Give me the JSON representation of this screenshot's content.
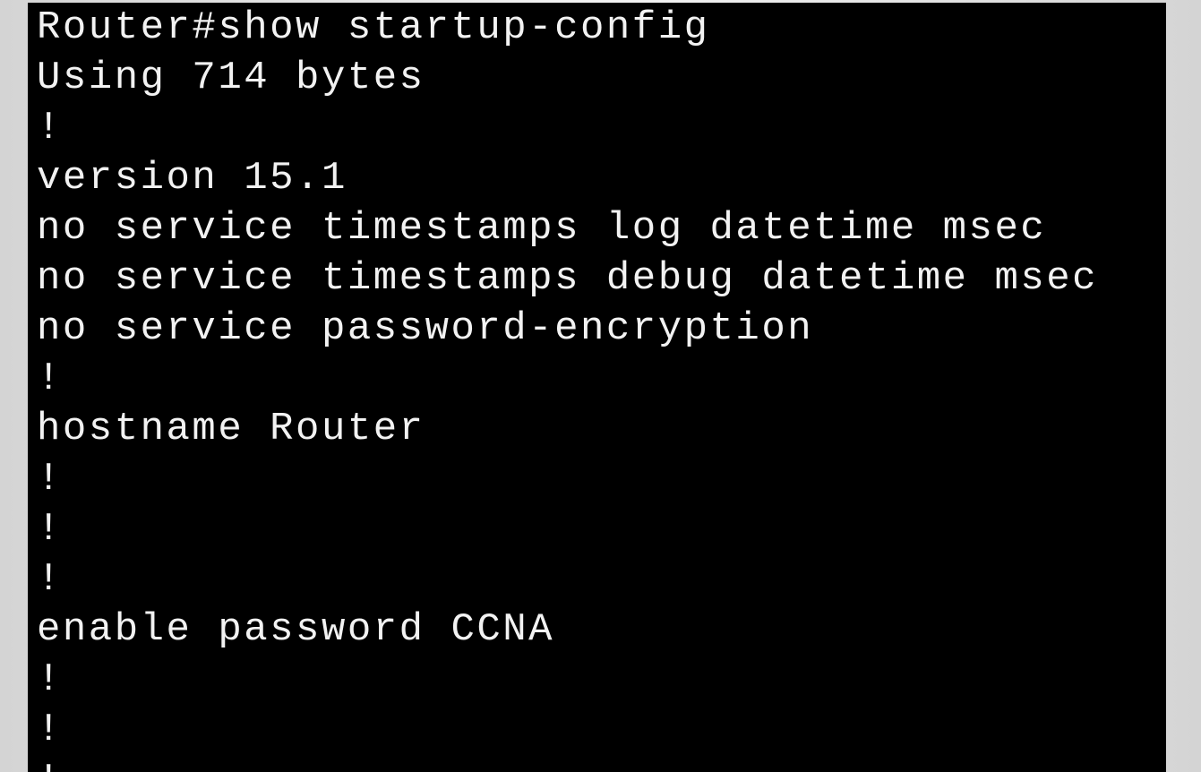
{
  "terminal": {
    "lines": [
      "Router#show startup-config",
      "Using 714 bytes",
      "!",
      "version 15.1",
      "no service timestamps log datetime msec",
      "no service timestamps debug datetime msec",
      "no service password-encryption",
      "!",
      "hostname Router",
      "!",
      "!",
      "!",
      "enable password CCNA",
      "!",
      "!",
      "!"
    ],
    "background_color": "#000000",
    "text_color": "#f2f2f2"
  }
}
